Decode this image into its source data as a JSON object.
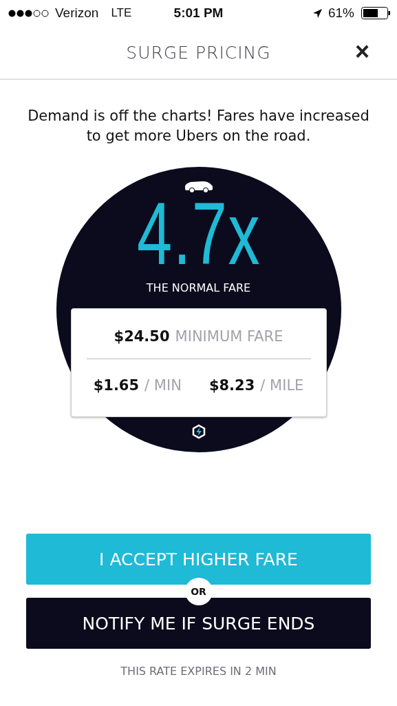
{
  "status_bar": {
    "carrier": "Verizon",
    "network": "LTE",
    "time": "5:01 PM",
    "battery": "61%"
  },
  "header": {
    "title": "SURGE PRICING",
    "close": "×"
  },
  "message": "Demand is off the charts! Fares have increased to get more Ubers on the road.",
  "surge": {
    "multiplier": "4.7x",
    "caption": "THE NORMAL FARE"
  },
  "fares": {
    "minimum": {
      "amount": "$24.50",
      "unit": "MINIMUM FARE"
    },
    "rates": [
      {
        "amount": "$1.65",
        "unit": "/ MIN"
      },
      {
        "amount": "$8.23",
        "unit": "/ MILE"
      }
    ]
  },
  "buttons": {
    "accept": "I ACCEPT HIGHER FARE",
    "or": "OR",
    "notify": "NOTIFY ME IF SURGE ENDS"
  },
  "expiry": "THIS RATE EXPIRES IN 2 MIN"
}
